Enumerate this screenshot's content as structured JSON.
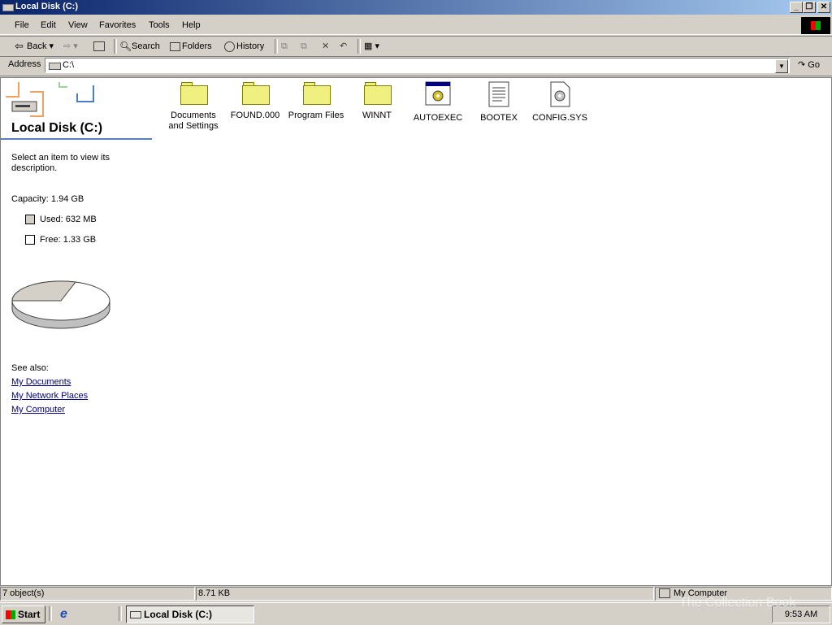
{
  "window": {
    "title": "Local Disk (C:)"
  },
  "menu": [
    {
      "label": "File"
    },
    {
      "label": "Edit"
    },
    {
      "label": "View"
    },
    {
      "label": "Favorites"
    },
    {
      "label": "Tools"
    },
    {
      "label": "Help"
    }
  ],
  "toolbar": {
    "back": "Back",
    "search": "Search",
    "folders": "Folders",
    "history": "History"
  },
  "address": {
    "label": "Address",
    "value": "C:\\",
    "go": "Go"
  },
  "panel": {
    "title": "Local Disk (C:)",
    "description": "Select an item to view its description.",
    "capacity": "Capacity: 1.94 GB",
    "used": "Used: 632 MB",
    "free": "Free: 1.33 GB",
    "used_color": "#d4d0c8",
    "free_color": "#ffffff",
    "see_also": "See also:",
    "links": [
      "My Documents",
      "My Network Places",
      "My Computer"
    ]
  },
  "files": [
    {
      "name": "Documents and Settings",
      "type": "folder"
    },
    {
      "name": "FOUND.000",
      "type": "folder"
    },
    {
      "name": "Program Files",
      "type": "folder"
    },
    {
      "name": "WINNT",
      "type": "folder"
    },
    {
      "name": "AUTOEXEC",
      "type": "batch-file"
    },
    {
      "name": "BOOTEX",
      "type": "text-file"
    },
    {
      "name": "CONFIG.SYS",
      "type": "system-file"
    }
  ],
  "status": {
    "objects": "7 object(s)",
    "size": "8.71 KB",
    "zone": "My Computer"
  },
  "taskbar": {
    "start": "Start",
    "task": "Local Disk (C:)",
    "clock": "9:53 AM"
  },
  "watermark": "The Collection Book"
}
